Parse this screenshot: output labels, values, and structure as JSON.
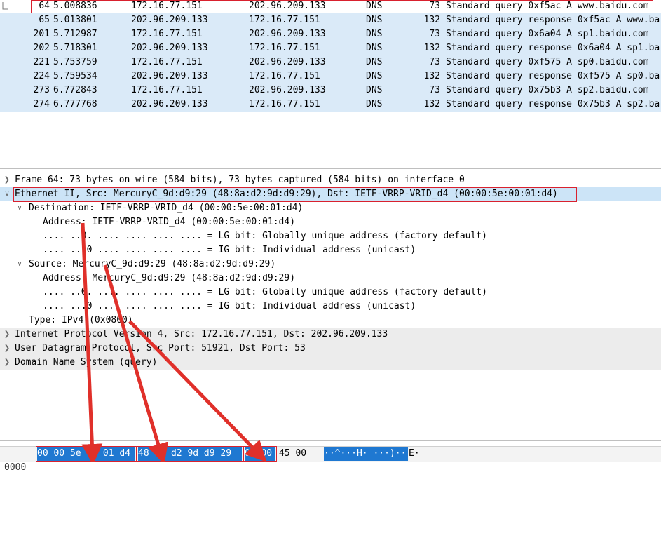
{
  "packet_list": {
    "rows": [
      {
        "no": "64",
        "time": "5.008836",
        "src": "172.16.77.151",
        "dst": "202.96.209.133",
        "proto": "DNS",
        "len": "73",
        "info": "Standard query 0xf5ac A www.baidu.com"
      },
      {
        "no": "65",
        "time": "5.013801",
        "src": "202.96.209.133",
        "dst": "172.16.77.151",
        "proto": "DNS",
        "len": "132",
        "info": "Standard query response 0xf5ac A www.ba"
      },
      {
        "no": "201",
        "time": "5.712987",
        "src": "172.16.77.151",
        "dst": "202.96.209.133",
        "proto": "DNS",
        "len": "73",
        "info": "Standard query 0x6a04 A sp1.baidu.com"
      },
      {
        "no": "202",
        "time": "5.718301",
        "src": "202.96.209.133",
        "dst": "172.16.77.151",
        "proto": "DNS",
        "len": "132",
        "info": "Standard query response 0x6a04 A sp1.ba"
      },
      {
        "no": "221",
        "time": "5.753759",
        "src": "172.16.77.151",
        "dst": "202.96.209.133",
        "proto": "DNS",
        "len": "73",
        "info": "Standard query 0xf575 A sp0.baidu.com"
      },
      {
        "no": "224",
        "time": "5.759534",
        "src": "202.96.209.133",
        "dst": "172.16.77.151",
        "proto": "DNS",
        "len": "132",
        "info": "Standard query response 0xf575 A sp0.ba"
      },
      {
        "no": "273",
        "time": "6.772843",
        "src": "172.16.77.151",
        "dst": "202.96.209.133",
        "proto": "DNS",
        "len": "73",
        "info": "Standard query 0x75b3 A sp2.baidu.com"
      },
      {
        "no": "274",
        "time": "6.777768",
        "src": "202.96.209.133",
        "dst": "172.16.77.151",
        "proto": "DNS",
        "len": "132",
        "info": "Standard query response 0x75b3 A sp2.ba"
      }
    ]
  },
  "details": {
    "frame": "Frame 64: 73 bytes on wire (584 bits), 73 bytes captured (584 bits) on interface 0",
    "ethernet": "Ethernet II, Src: MercuryC_9d:d9:29 (48:8a:d2:9d:d9:29), Dst: IETF-VRRP-VRID_d4 (00:00:5e:00:01:d4)",
    "destination": "Destination: IETF-VRRP-VRID_d4 (00:00:5e:00:01:d4)",
    "dst_address": "Address: IETF-VRRP-VRID_d4 (00:00:5e:00:01:d4)",
    "dst_lg": ".... ..0. .... .... .... .... = LG bit: Globally unique address (factory default)",
    "dst_ig": ".... ...0 .... .... .... .... = IG bit: Individual address (unicast)",
    "source": "Source: MercuryC_9d:d9:29 (48:8a:d2:9d:d9:29)",
    "src_address": "Address: MercuryC_9d:d9:29 (48:8a:d2:9d:d9:29)",
    "src_lg": ".... ..0. .... .... .... .... = LG bit: Globally unique address (factory default)",
    "src_ig": ".... ...0 .... .... .... .... = IG bit: Individual address (unicast)",
    "type": "Type: IPv4 (0x0800)",
    "ip": "Internet Protocol Version 4, Src: 172.16.77.151, Dst: 202.96.209.133",
    "udp": "User Datagram Protocol, Src Port: 51921, Dst Port: 53",
    "dns": "Domain Name System (query)"
  },
  "hex": {
    "offset": "0000",
    "dst_bytes": "00 00 5e 00 01 d4",
    "src_bytes": "48 8a d2 9d d9 29",
    "type_bytes": "08 00",
    "rest_bytes": "45 00",
    "ascii_selected": "··^···H· ···)··",
    "ascii_rest": "E·"
  },
  "colors": {
    "row_bg": "#daeaf8",
    "selection_blue": "#1f78d1",
    "annotation_red": "#e0302a"
  }
}
